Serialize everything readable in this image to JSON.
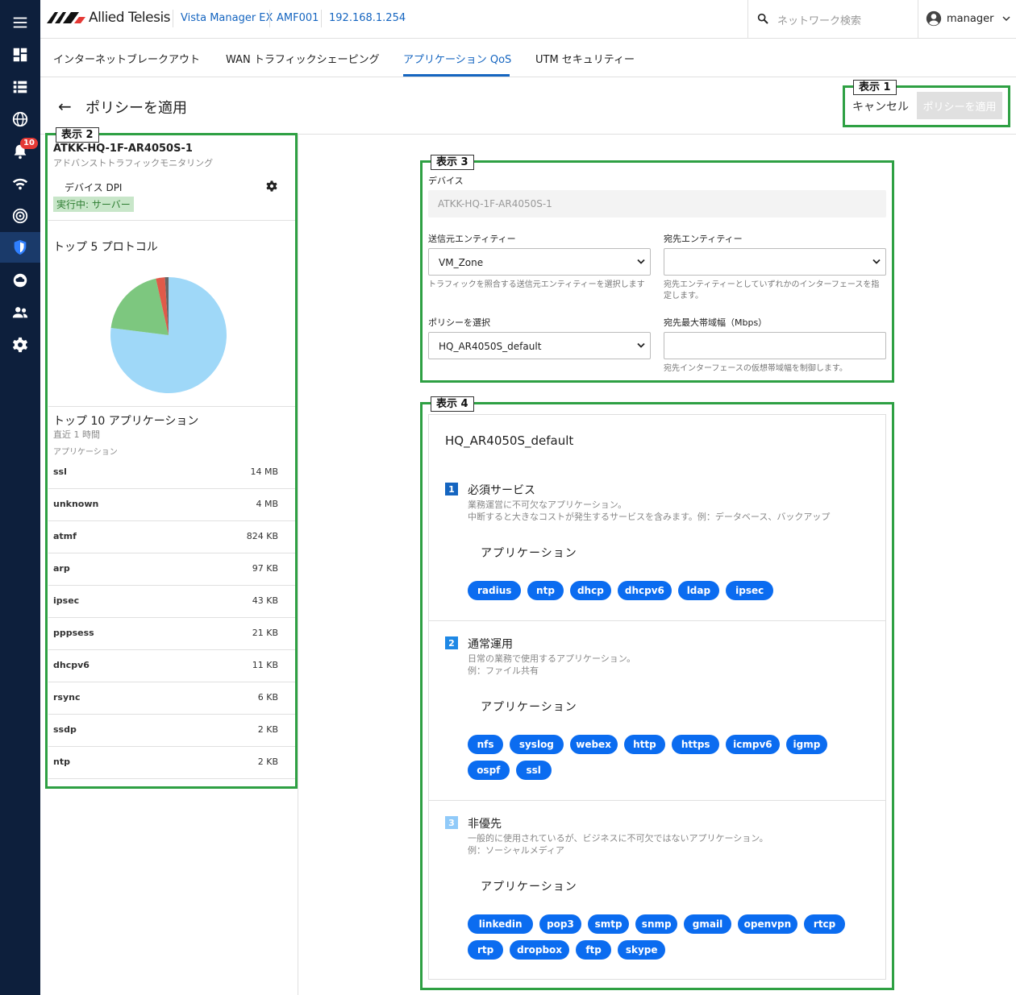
{
  "header": {
    "brand": "Allied Telesis",
    "breadcrumbs": [
      "Vista Manager EX",
      "AMF001",
      "192.168.1.254"
    ],
    "search_placeholder": "ネットワーク検索",
    "user": "manager"
  },
  "nav": {
    "alert_count": "10"
  },
  "tabs": [
    "インターネットブレークアウト",
    "WAN トラフィックシェーピング",
    "アプリケーション QoS",
    "UTM セキュリティー"
  ],
  "active_tab": "アプリケーション QoS",
  "page": {
    "title": "ポリシーを適用",
    "cancel_label": "キャンセル",
    "apply_label": "ポリシーを適用"
  },
  "annotations": [
    "表示 1",
    "表示 2",
    "表示 3",
    "表示 4"
  ],
  "device_panel": {
    "name": "ATKK-HQ-1F-AR4050S-1",
    "subtitle": "アドバンストトラフィックモニタリング",
    "dpi_label": "デバイス DPI",
    "status": "実行中: サーバー",
    "protocols_title": "トップ 5 プロトコル",
    "apps_title": "トップ 10 アプリケーション",
    "apps_period": "直近 1 時間",
    "apps_col": "アプリケーション",
    "apps": [
      {
        "name": "ssl",
        "value": "14 MB"
      },
      {
        "name": "unknown",
        "value": "4 MB"
      },
      {
        "name": "atmf",
        "value": "824 KB"
      },
      {
        "name": "arp",
        "value": "97 KB"
      },
      {
        "name": "ipsec",
        "value": "43 KB"
      },
      {
        "name": "pppsess",
        "value": "21 KB"
      },
      {
        "name": "dhcpv6",
        "value": "11 KB"
      },
      {
        "name": "rsync",
        "value": "6 KB"
      },
      {
        "name": "ssdp",
        "value": "2 KB"
      },
      {
        "name": "ntp",
        "value": "2 KB"
      }
    ]
  },
  "chart_data": {
    "type": "pie",
    "values": [
      77,
      19.5,
      2.5,
      1
    ],
    "colors": [
      "#9fd8f8",
      "#7dc77f",
      "#e05a4a",
      "#666666"
    ]
  },
  "form": {
    "device_label": "デバイス",
    "device_value": "ATKK-HQ-1F-AR4050S-1",
    "src_label": "送信元エンティティー",
    "src_value": "VM_Zone",
    "src_hint": "トラフィックを照合する送信元エンティティーを選択します",
    "dst_label": "宛先エンティティー",
    "dst_value": "",
    "dst_hint_1": "宛先エンティティーとしていずれかのインターフェースを指",
    "dst_hint_2": "定します。",
    "policy_label": "ポリシーを選択",
    "policy_value": "HQ_AR4050S_default",
    "bw_label": "宛先最大帯域幅（Mbps）",
    "bw_value": "",
    "bw_hint": "宛先インターフェースの仮想帯域幅を制御します。"
  },
  "policy": {
    "name": "HQ_AR4050S_default",
    "app_heading": "アプリケーション",
    "categories": [
      {
        "num": "1",
        "title": "必須サービス",
        "desc1": "業務運営に不可欠なアプリケーション。",
        "desc2": "中断すると大きなコストが発生するサービスを含みます。例：データベース、バックアップ",
        "apps": [
          "radius",
          "ntp",
          "dhcp",
          "dhcpv6",
          "ldap",
          "ipsec"
        ]
      },
      {
        "num": "2",
        "title": "通常運用",
        "desc1": "日常の業務で使用するアプリケーション。",
        "desc2": "例：ファイル共有",
        "apps": [
          "nfs",
          "syslog",
          "webex",
          "http",
          "https",
          "icmpv6",
          "igmp",
          "ospf",
          "ssl"
        ]
      },
      {
        "num": "3",
        "title": "非優先",
        "desc1": "一般的に使用されているが、ビジネスに不可欠ではないアプリケーション。",
        "desc2": "例：ソーシャルメディア",
        "apps": [
          "linkedin",
          "pop3",
          "smtp",
          "snmp",
          "gmail",
          "openvpn",
          "rtcp",
          "rtp",
          "dropbox",
          "ftp",
          "skype"
        ]
      }
    ]
  },
  "colors": {
    "accent": "#1565c0",
    "chip": "#0b6cf0",
    "annotation": "#2ea043",
    "nav": "#0d1f3c"
  }
}
